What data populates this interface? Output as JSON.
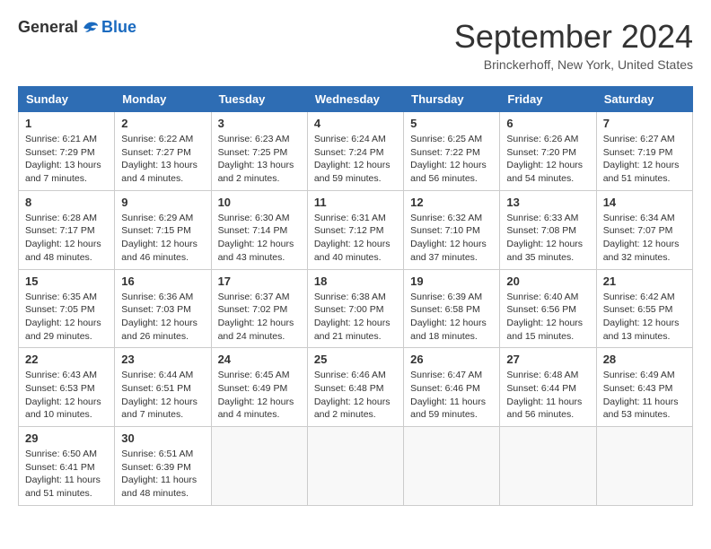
{
  "logo": {
    "general": "General",
    "blue": "Blue"
  },
  "title": "September 2024",
  "location": "Brinckerhoff, New York, United States",
  "headers": [
    "Sunday",
    "Monday",
    "Tuesday",
    "Wednesday",
    "Thursday",
    "Friday",
    "Saturday"
  ],
  "weeks": [
    [
      {
        "day": "1",
        "info": "Sunrise: 6:21 AM\nSunset: 7:29 PM\nDaylight: 13 hours\nand 7 minutes."
      },
      {
        "day": "2",
        "info": "Sunrise: 6:22 AM\nSunset: 7:27 PM\nDaylight: 13 hours\nand 4 minutes."
      },
      {
        "day": "3",
        "info": "Sunrise: 6:23 AM\nSunset: 7:25 PM\nDaylight: 13 hours\nand 2 minutes."
      },
      {
        "day": "4",
        "info": "Sunrise: 6:24 AM\nSunset: 7:24 PM\nDaylight: 12 hours\nand 59 minutes."
      },
      {
        "day": "5",
        "info": "Sunrise: 6:25 AM\nSunset: 7:22 PM\nDaylight: 12 hours\nand 56 minutes."
      },
      {
        "day": "6",
        "info": "Sunrise: 6:26 AM\nSunset: 7:20 PM\nDaylight: 12 hours\nand 54 minutes."
      },
      {
        "day": "7",
        "info": "Sunrise: 6:27 AM\nSunset: 7:19 PM\nDaylight: 12 hours\nand 51 minutes."
      }
    ],
    [
      {
        "day": "8",
        "info": "Sunrise: 6:28 AM\nSunset: 7:17 PM\nDaylight: 12 hours\nand 48 minutes."
      },
      {
        "day": "9",
        "info": "Sunrise: 6:29 AM\nSunset: 7:15 PM\nDaylight: 12 hours\nand 46 minutes."
      },
      {
        "day": "10",
        "info": "Sunrise: 6:30 AM\nSunset: 7:14 PM\nDaylight: 12 hours\nand 43 minutes."
      },
      {
        "day": "11",
        "info": "Sunrise: 6:31 AM\nSunset: 7:12 PM\nDaylight: 12 hours\nand 40 minutes."
      },
      {
        "day": "12",
        "info": "Sunrise: 6:32 AM\nSunset: 7:10 PM\nDaylight: 12 hours\nand 37 minutes."
      },
      {
        "day": "13",
        "info": "Sunrise: 6:33 AM\nSunset: 7:08 PM\nDaylight: 12 hours\nand 35 minutes."
      },
      {
        "day": "14",
        "info": "Sunrise: 6:34 AM\nSunset: 7:07 PM\nDaylight: 12 hours\nand 32 minutes."
      }
    ],
    [
      {
        "day": "15",
        "info": "Sunrise: 6:35 AM\nSunset: 7:05 PM\nDaylight: 12 hours\nand 29 minutes."
      },
      {
        "day": "16",
        "info": "Sunrise: 6:36 AM\nSunset: 7:03 PM\nDaylight: 12 hours\nand 26 minutes."
      },
      {
        "day": "17",
        "info": "Sunrise: 6:37 AM\nSunset: 7:02 PM\nDaylight: 12 hours\nand 24 minutes."
      },
      {
        "day": "18",
        "info": "Sunrise: 6:38 AM\nSunset: 7:00 PM\nDaylight: 12 hours\nand 21 minutes."
      },
      {
        "day": "19",
        "info": "Sunrise: 6:39 AM\nSunset: 6:58 PM\nDaylight: 12 hours\nand 18 minutes."
      },
      {
        "day": "20",
        "info": "Sunrise: 6:40 AM\nSunset: 6:56 PM\nDaylight: 12 hours\nand 15 minutes."
      },
      {
        "day": "21",
        "info": "Sunrise: 6:42 AM\nSunset: 6:55 PM\nDaylight: 12 hours\nand 13 minutes."
      }
    ],
    [
      {
        "day": "22",
        "info": "Sunrise: 6:43 AM\nSunset: 6:53 PM\nDaylight: 12 hours\nand 10 minutes."
      },
      {
        "day": "23",
        "info": "Sunrise: 6:44 AM\nSunset: 6:51 PM\nDaylight: 12 hours\nand 7 minutes."
      },
      {
        "day": "24",
        "info": "Sunrise: 6:45 AM\nSunset: 6:49 PM\nDaylight: 12 hours\nand 4 minutes."
      },
      {
        "day": "25",
        "info": "Sunrise: 6:46 AM\nSunset: 6:48 PM\nDaylight: 12 hours\nand 2 minutes."
      },
      {
        "day": "26",
        "info": "Sunrise: 6:47 AM\nSunset: 6:46 PM\nDaylight: 11 hours\nand 59 minutes."
      },
      {
        "day": "27",
        "info": "Sunrise: 6:48 AM\nSunset: 6:44 PM\nDaylight: 11 hours\nand 56 minutes."
      },
      {
        "day": "28",
        "info": "Sunrise: 6:49 AM\nSunset: 6:43 PM\nDaylight: 11 hours\nand 53 minutes."
      }
    ],
    [
      {
        "day": "29",
        "info": "Sunrise: 6:50 AM\nSunset: 6:41 PM\nDaylight: 11 hours\nand 51 minutes."
      },
      {
        "day": "30",
        "info": "Sunrise: 6:51 AM\nSunset: 6:39 PM\nDaylight: 11 hours\nand 48 minutes."
      },
      {
        "day": "",
        "info": ""
      },
      {
        "day": "",
        "info": ""
      },
      {
        "day": "",
        "info": ""
      },
      {
        "day": "",
        "info": ""
      },
      {
        "day": "",
        "info": ""
      }
    ]
  ]
}
